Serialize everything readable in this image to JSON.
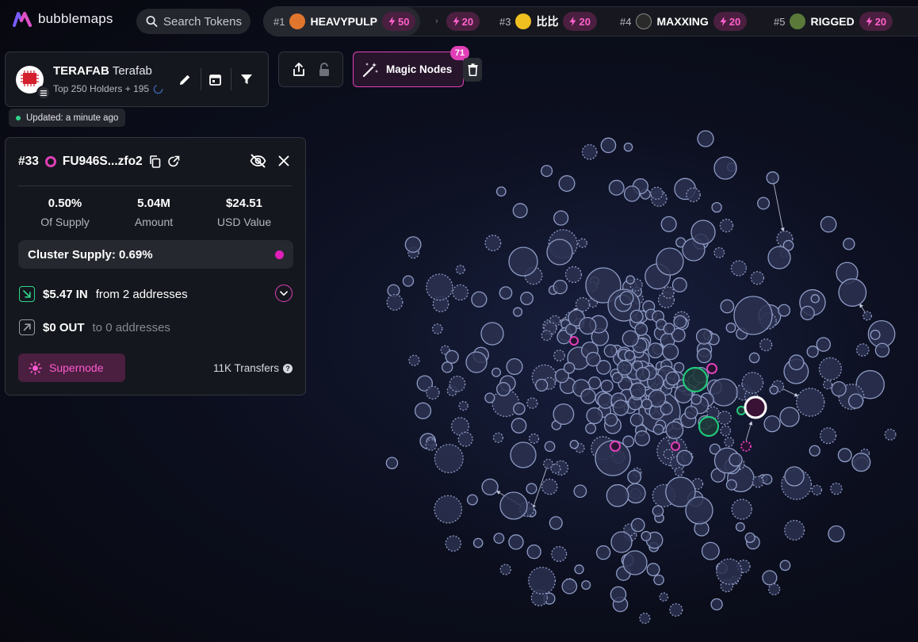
{
  "app": {
    "name": "bubblemaps"
  },
  "search": {
    "placeholder": "Search Tokens"
  },
  "trending": [
    {
      "rank": "#1",
      "name": "HEAVYPULP",
      "boost": "50",
      "avatar_color": "#e0762d"
    },
    {
      "rank": "",
      "name": "",
      "boost": "20",
      "avatar_color": ""
    },
    {
      "rank": "#3",
      "name": "比比",
      "boost": "20",
      "avatar_color": "#f0c020"
    },
    {
      "rank": "#4",
      "name": "MAXXING",
      "boost": "20",
      "avatar_color": "#2a2a2a"
    },
    {
      "rank": "#5",
      "name": "RIGGED",
      "boost": "20",
      "avatar_color": "#5b7a3a"
    }
  ],
  "token": {
    "symbol": "TERAFAB",
    "name": "Terafab",
    "holders": "Top 250 Holders + 195",
    "updated": "Updated: a minute ago"
  },
  "magic_nodes": {
    "label": "Magic Nodes",
    "count": "71"
  },
  "details": {
    "rank": "#33",
    "address": "FU946S...zfo2",
    "stats": [
      {
        "value": "0.50%",
        "label": "Of Supply"
      },
      {
        "value": "5.04M",
        "label": "Amount"
      },
      {
        "value": "$24.51",
        "label": "USD Value"
      }
    ],
    "cluster_supply": "Cluster Supply: 0.69%",
    "in": {
      "amount": "$5.47 IN",
      "desc": "from 2 addresses"
    },
    "out": {
      "amount": "$0 OUT",
      "desc": "to 0 addresses"
    },
    "supernode_label": "Supernode",
    "transfers": "11K Transfers"
  },
  "colors": {
    "accent": "#e040b8",
    "bubble_fill": "#2b3150",
    "bubble_stroke": "#8e9bc4",
    "highlight_green": "#22c77a",
    "selected": "#ffffff"
  }
}
